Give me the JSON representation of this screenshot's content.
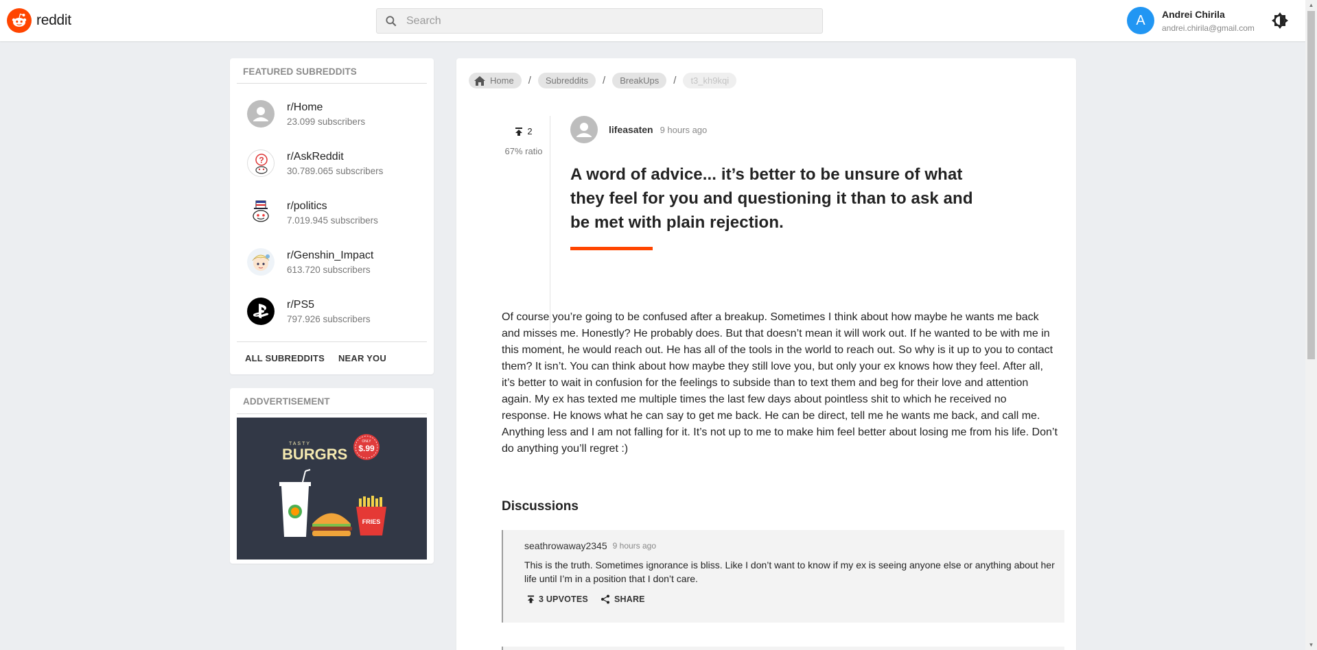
{
  "header": {
    "logo_text": "reddit",
    "search_placeholder": "Search",
    "user": {
      "initial": "A",
      "name": "Andrei Chirila",
      "email": "andrei.chirila@gmail.com"
    }
  },
  "sidebar": {
    "featured_title": "FEATURED SUBREDDITS",
    "subreddits": [
      {
        "name": "r/Home",
        "subscribers": "23.099 subscribers",
        "icon": "default-avatar-icon"
      },
      {
        "name": "r/AskReddit",
        "subscribers": "30.789.065 subscribers",
        "icon": "askreddit-icon"
      },
      {
        "name": "r/politics",
        "subscribers": "7.019.945 subscribers",
        "icon": "politics-icon"
      },
      {
        "name": "r/Genshin_Impact",
        "subscribers": "613.720 subscribers",
        "icon": "genshin-icon"
      },
      {
        "name": "r/PS5",
        "subscribers": "797.926 subscribers",
        "icon": "playstation-icon"
      }
    ],
    "links": [
      "ALL SUBREDDITS",
      "NEAR YOU"
    ],
    "ad_title": "ADDVERTISEMENT",
    "ad": {
      "brand_small": "TASTY",
      "brand": "BURGRS",
      "price_small": "ONLY",
      "price": "$.99",
      "fries": "FRIES"
    }
  },
  "breadcrumb": [
    "Home",
    "Subreddits",
    "BreakUps",
    "t3_kh9kqi"
  ],
  "post": {
    "score": "2",
    "ratio": "67% ratio",
    "author": "lifeasaten",
    "time": "9 hours ago",
    "title": "A word of advice... it’s better to be unsure of what they feel for you and questioning it than to ask and be met with plain rejection.",
    "body": "Of course you’re going to be confused after a breakup. Sometimes I think about how maybe he wants me back and misses me. Honestly? He probably does. But that doesn’t mean it will work out. If he wanted to be with me in this moment, he would reach out. He has all of the tools in the world to reach out. So why is it up to you to contact them? It isn’t. You can think about how maybe they still love you, but only your ex knows how they feel. After all, it’s better to wait in confusion for the feelings to subside than to text them and beg for their love and attention again. My ex has texted me multiple times the last few days about pointless shit to which he received no response. He knows what he can say to get me back. He can be direct, tell me he wants me back, and call me. Anything less and I am not falling for it. It’s not up to me to make him feel better about losing me from his life. Don’t do anything you’ll regret :)"
  },
  "discussions": {
    "title": "Discussions",
    "comments": [
      {
        "user": "seathrowaway2345",
        "time": "9 hours ago",
        "text": "This is the truth. Sometimes ignorance is bliss. Like I don’t want to know if my ex is seeing anyone else or anything about her life until I’m in a position that I don’t care.",
        "upvotes_label": "3 UPVOTES",
        "share_label": "SHARE"
      }
    ]
  },
  "colors": {
    "accent": "#ff4500",
    "avatar": "#2196f3",
    "background": "#eceef1"
  }
}
